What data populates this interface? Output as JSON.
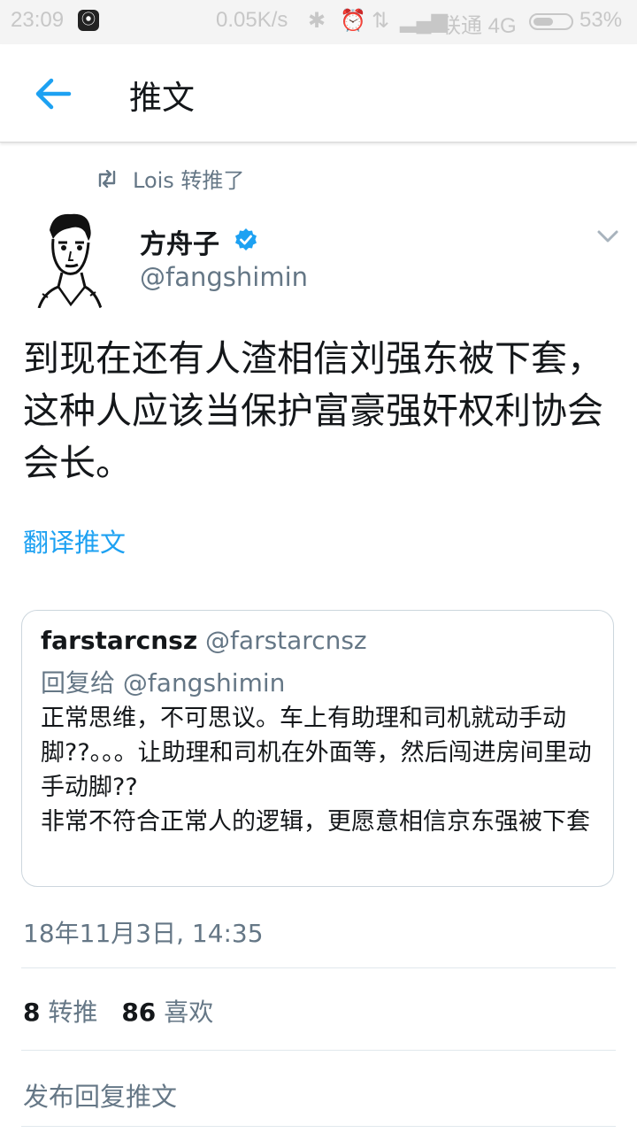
{
  "status_bar": {
    "time": "23:09",
    "network_speed": "0.05K/s",
    "carrier": "联通 4G",
    "battery_percent": "53%"
  },
  "app_bar": {
    "title": "推文"
  },
  "tweet": {
    "retweeted_by": "Lois 转推了",
    "author_name": "方舟子",
    "author_handle": "@fangshimin",
    "verified": true,
    "text": "到现在还有人渣相信刘强东被下套，这种人应该当保护富豪强奸权利协会会长。",
    "translate_label": "翻译推文",
    "quoted": {
      "author_name": "farstarcnsz",
      "author_handle": "@farstarcnsz",
      "reply_prefix": "回复给",
      "reply_to": "@fangshimin",
      "text": "正常思维，不可思议。车上有助理和司机就动手动脚??。。。让助理和司机在外面等，然后闯进房间里动手动脚??\n非常不符合正常人的逻辑，更愿意相信京东强被下套"
    },
    "timestamp": "18年11月3日, 14:35",
    "retweet_count": "8",
    "retweet_label": "转推",
    "like_count": "86",
    "like_label": "喜欢",
    "reply_placeholder": "发布回复推文"
  },
  "colors": {
    "accent": "#1da1f2",
    "secondary_text": "#657786",
    "primary_text": "#14171a",
    "border": "#ccd6dd"
  }
}
